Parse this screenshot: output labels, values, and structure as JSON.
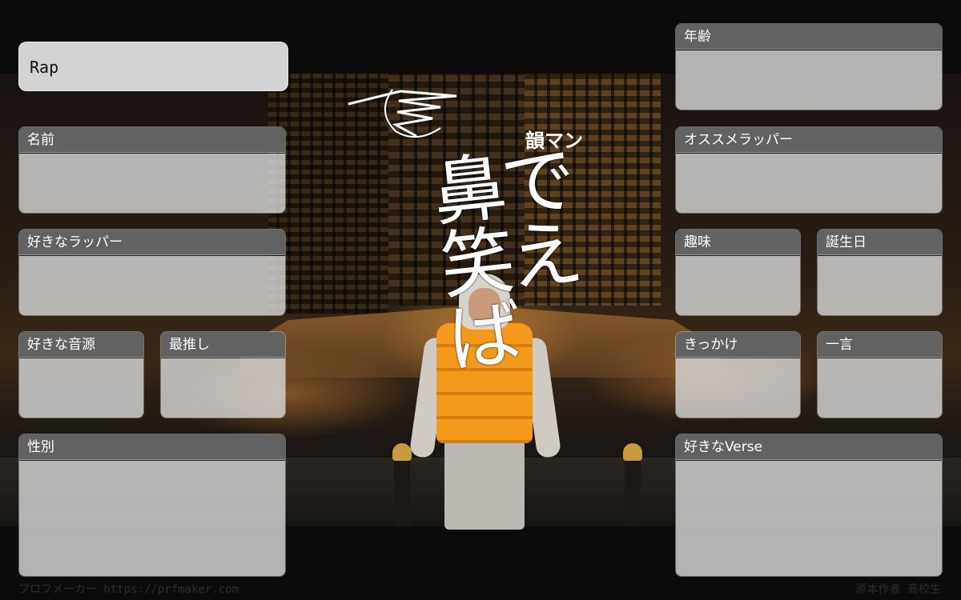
{
  "header": {
    "rap_label": "Rap"
  },
  "artwork": {
    "title": "鼻で笑えば",
    "artist": "韻マン"
  },
  "fields": {
    "name": "名前",
    "fav_rapper": "好きなラッパー",
    "fav_track": "好きな音源",
    "oshi": "最推し",
    "gender": "性別",
    "age": "年齢",
    "recommend_rapper": "オススメラッパー",
    "hobby": "趣味",
    "birthday": "誕生日",
    "trigger": "きっかけ",
    "one_word": "一言",
    "fav_verse": "好きなVerse"
  },
  "footer": {
    "maker": "プロフメーカー https://prfmaker.com",
    "credit": "原本作者 髙校生"
  }
}
